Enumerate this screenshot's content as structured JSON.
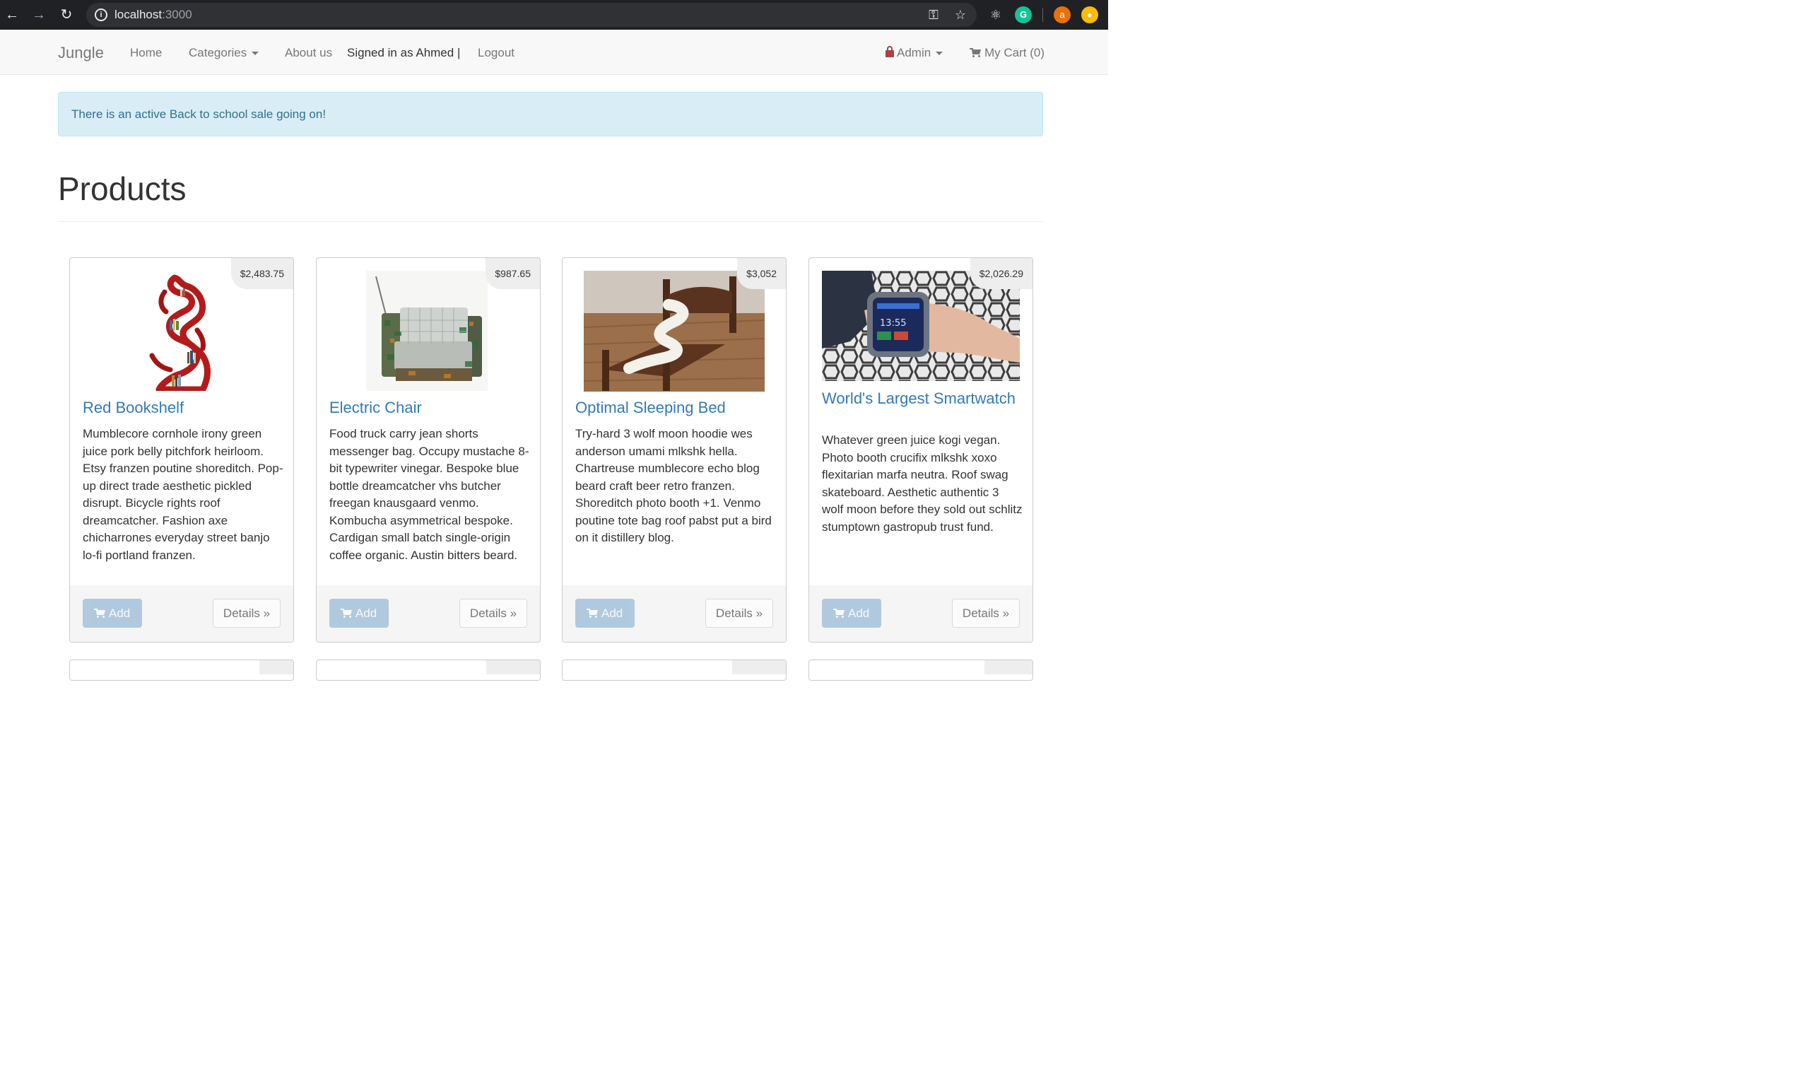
{
  "browser": {
    "host": "localhost",
    "port": ":3000"
  },
  "navbar": {
    "brand": "Jungle",
    "home": "Home",
    "categories": "Categories",
    "about": "About us",
    "signed_in": "Signed in as Ahmed |",
    "logout": "Logout",
    "admin": "Admin",
    "cart": "My Cart (0)"
  },
  "alert": {
    "text": "There is an active Back to school sale going on!"
  },
  "page": {
    "title": "Products"
  },
  "products": [
    {
      "name": "Red Bookshelf",
      "price": "$2,483.75",
      "description": "Mumblecore cornhole irony green juice pork belly pitchfork heirloom. Etsy franzen poutine shoreditch. Pop-up direct trade aesthetic pickled disrupt. Bicycle rights roof dreamcatcher. Fashion axe chicharrones everyday street banjo lo-fi portland franzen.",
      "add": "Add",
      "details": "Details »"
    },
    {
      "name": "Electric Chair",
      "price": "$987.65",
      "description": "Food truck carry jean shorts messenger bag. Occupy mustache 8-bit typewriter vinegar. Bespoke blue bottle dreamcatcher vhs butcher freegan knausgaard venmo. Kombucha asymmetrical bespoke. Cardigan small batch single-origin coffee organic. Austin bitters beard.",
      "add": "Add",
      "details": "Details »"
    },
    {
      "name": "Optimal Sleeping Bed",
      "price": "$3,052",
      "description": "Try-hard 3 wolf moon hoodie wes anderson umami mlkshk hella. Chartreuse mumblecore echo blog beard craft beer retro franzen. Shoreditch photo booth +1. Venmo poutine tote bag roof pabst put a bird on it distillery blog.",
      "add": "Add",
      "details": "Details »"
    },
    {
      "name": "World's Largest Smartwatch",
      "price": "$2,026.29",
      "description": "Whatever green juice kogi vegan. Photo booth crucifix mlkshk xoxo flexitarian marfa neutra. Roof swag skateboard. Aesthetic authentic 3 wolf moon before they sold out schlitz stumptown gastropub trust fund.",
      "add": "Add",
      "details": "Details »",
      "watch_time": "13:55"
    }
  ],
  "colors": {
    "link": "#337ab7",
    "admin": "#a94442",
    "alert_bg": "#d9edf7",
    "alert_text": "#31708f"
  },
  "icons": [
    "back-arrow-icon",
    "forward-arrow-icon",
    "reload-icon",
    "info-icon",
    "key-icon",
    "star-icon",
    "react-icon",
    "grammarly-icon",
    "profile-avatar-icon",
    "extension-icon",
    "lock-icon",
    "cart-icon",
    "caret-down-icon"
  ],
  "extensions": {
    "profile_initial": "a",
    "grammarly": "G"
  }
}
